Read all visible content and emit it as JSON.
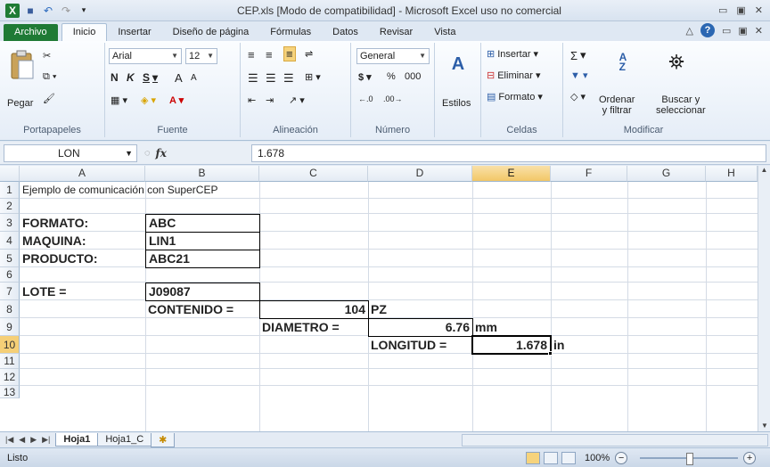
{
  "window": {
    "title": "CEP.xls  [Modo de compatibilidad]  -  Microsoft Excel uso no comercial"
  },
  "tabs": [
    "Archivo",
    "Inicio",
    "Insertar",
    "Diseño de página",
    "Fórmulas",
    "Datos",
    "Revisar",
    "Vista"
  ],
  "ribbon": {
    "clipboard": {
      "paste": "Pegar",
      "label": "Portapapeles"
    },
    "font": {
      "name": "Arial",
      "size": "12",
      "bold": "N",
      "italic": "K",
      "underline": "S",
      "grow": "A",
      "shrink": "A",
      "label": "Fuente"
    },
    "alignment": {
      "label": "Alineación"
    },
    "number": {
      "format": "General",
      "currency": "$",
      "percent": "%",
      "thousands": "000",
      "label": "Número"
    },
    "styles": {
      "label": "Estilos"
    },
    "cells": {
      "insert": "Insertar",
      "delete": "Eliminar",
      "format": "Formato",
      "label": "Celdas"
    },
    "editing": {
      "sigma": "Σ",
      "sort": "Ordenar\ny filtrar",
      "find": "Buscar y\nseleccionar",
      "label": "Modificar"
    }
  },
  "formula_bar": {
    "name_box": "LON",
    "fx": "fx",
    "value": "1.678"
  },
  "columns": [
    "A",
    "B",
    "C",
    "D",
    "E",
    "F",
    "G",
    "H"
  ],
  "rows": [
    "1",
    "2",
    "3",
    "4",
    "5",
    "6",
    "7",
    "8",
    "9",
    "10",
    "11",
    "12",
    "13"
  ],
  "cells": {
    "A1": "Ejemplo de comunicación con SuperCEP",
    "A3": "FORMATO:",
    "B3": "ABC",
    "A4": "MAQUINA:",
    "B4": "LIN1",
    "A5": "PRODUCTO:",
    "B5": "ABC21",
    "A7": "LOTE =",
    "B7": "J09087",
    "B8": "CONTENIDO =",
    "C8": "104",
    "D8": "PZ",
    "C9": "DIAMETRO =",
    "D9": "6.76",
    "E9": "mm",
    "D10": "LONGITUD =",
    "E10": "1.678",
    "F10": "in"
  },
  "sheets": [
    "Hoja1",
    "Hoja1_C"
  ],
  "status": {
    "ready": "Listo",
    "zoom": "100%"
  }
}
